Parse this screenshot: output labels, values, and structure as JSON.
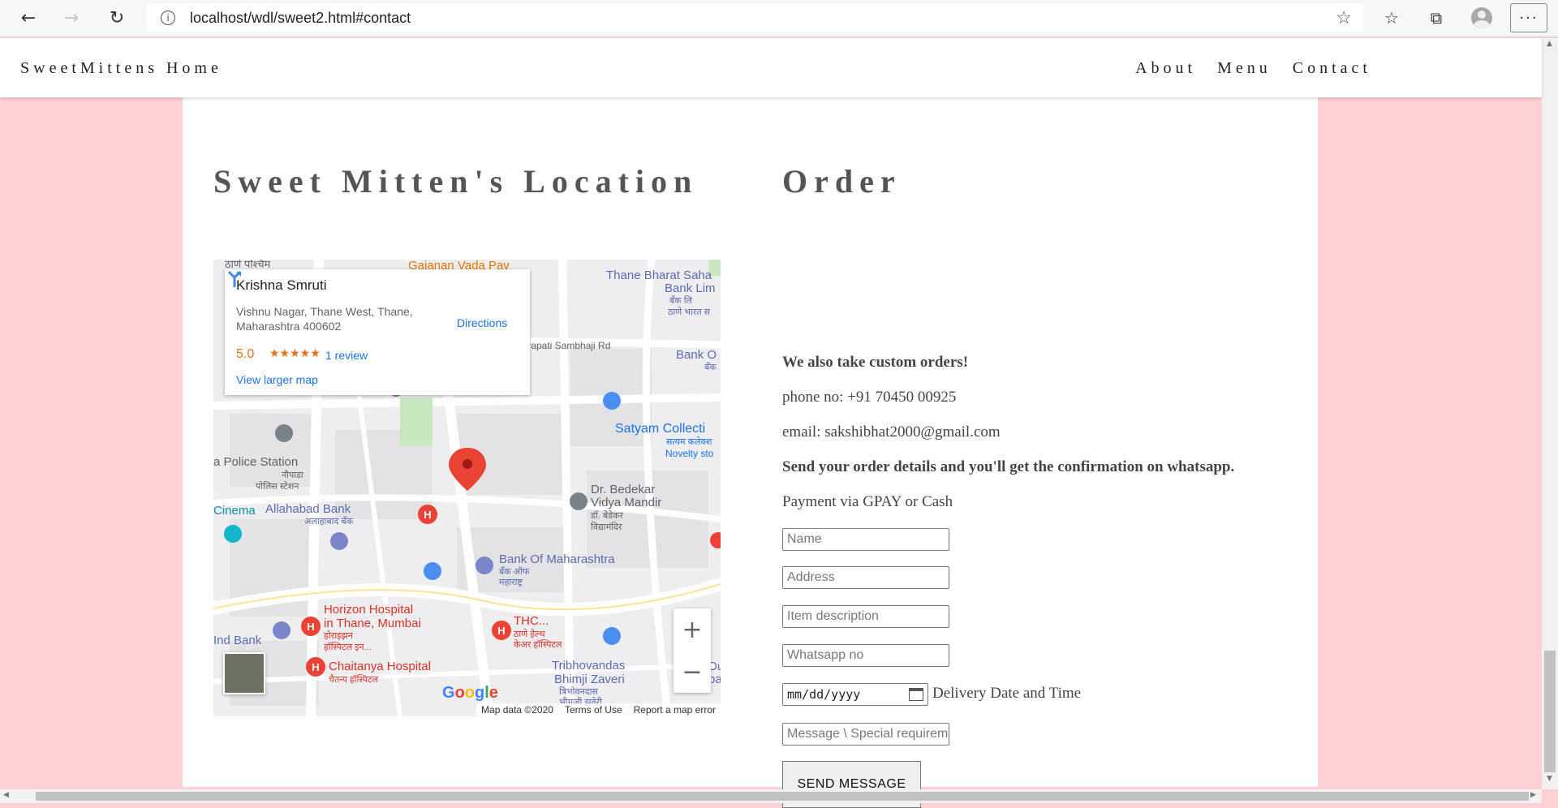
{
  "browser": {
    "url": "localhost/wdl/sweet2.html#contact"
  },
  "site": {
    "brand": "SweetMittens Home",
    "nav": [
      "About",
      "Menu",
      "Contact"
    ]
  },
  "location": {
    "title": "Sweet Mitten's Location",
    "map": {
      "place_name": "Krishna Smruti",
      "address": "Vishnu Nagar, Thane West, Thane, Maharashtra 400602",
      "rating": "5.0",
      "stars": "★★★★★",
      "reviews": "1 review",
      "larger_map": "View larger map",
      "directions": "Directions",
      "pin_label": "Krishna Smruti",
      "footer": [
        "Map data ©2020",
        "Terms of Use",
        "Report a map error"
      ],
      "google": "Google",
      "labels": {
        "thane_west": "ठाणे पश्चिम",
        "gajanan": "Gajanan Vada Pav",
        "thane_bharat": "Thane Bharat Saha",
        "bank_lim": "Bank Lim",
        "bank_hi": "बँक लि",
        "thane_bharat_hi": "ठाणे भारत स",
        "chhatrapati": "trapati Sambhaji Rd",
        "bank_o": "Bank O",
        "bank_o_hi": "बँक",
        "satyam": "Satyam Collecti",
        "satyam_hi": "सत्यम कलेक्श",
        "novelty": "Novelty sto",
        "police": "a Police Station",
        "naupada": "नौपाडा",
        "police_hi": "पोलिस स्टेशन",
        "bedekar": "Dr. Bedekar",
        "vidya": "Vidya Mandir",
        "bedekar_hi": "डॉ. बेडेकर",
        "vidyamandir_hi": "विद्यामंदिर",
        "cinema": "Cinema",
        "allahabad": "Allahabad Bank",
        "allahabad_hi": "अलाहाबाद बँक",
        "bom": "Bank Of Maharashtra",
        "bom_hi": "बँक ऑफ",
        "maharashtra_hi": "महाराष्ट्र",
        "horizon": "Horizon Hospital",
        "horizon2": "in Thane, Mumbai",
        "horizon_hi": "होराइझन",
        "horizon_hi2": "हॉस्पिटल इन...",
        "thc": "THC...",
        "thc_hi": "ठाणे हेल्थ",
        "thc_hi2": "केअर हॉस्पिटल",
        "ind_bank": "Ind Bank",
        "chaitanya": "Chaitanya Hospital",
        "chaitanya_hi": "चैतन्य हॉस्पिटल",
        "tribhovandas": "Tribhovandas",
        "bhimji": "Bhimji Zaveri",
        "tribhovandas_hi": "त्रिभोवनदास",
        "bhimji_hi": "भीमजी झवेरी",
        "du": "Du",
        "ba": "ba"
      }
    }
  },
  "order": {
    "title": "Order",
    "custom": "We also take custom orders!",
    "phone": "phone no: +91 70450 00925",
    "email": "email: sakshibhat2000@gmail.com",
    "send_details": "Send your order details and you'll get the confirmation on whatsapp.",
    "payment": "Payment via GPAY or Cash",
    "fields": {
      "name": "Name",
      "address": "Address",
      "item": "Item description",
      "whatsapp": "Whatsapp no",
      "date": "mm/dd/yyyy",
      "date_label": "Delivery Date and Time",
      "message": "Message \\ Special requirements"
    },
    "submit": "SEND MESSAGE"
  }
}
